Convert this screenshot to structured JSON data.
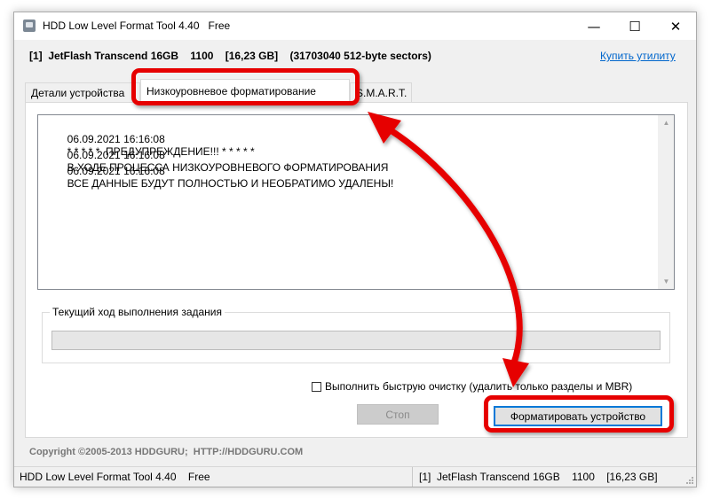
{
  "window": {
    "title": "HDD Low Level Format Tool 4.40   Free",
    "minimize_glyph": "—",
    "maximize_glyph": "☐",
    "close_glyph": "✕"
  },
  "device": {
    "info": "[1]  JetFlash Transcend 16GB    1100    [16,23 GB]    (31703040 512-byte sectors)",
    "buy_link": "Купить утилиту"
  },
  "tabs": [
    {
      "label": "Детали устройства"
    },
    {
      "label": "Низкоуровневое форматирование"
    },
    {
      "label": "S.M.A.R.T."
    }
  ],
  "log": [
    {
      "time": "06.09.2021 16:16:08",
      "text": "* * * * *  ПРЕДУПРЕЖДЕНИЕ!!! * * * * *"
    },
    {
      "time": "06.09.2021 16:16:08",
      "text": "В ХОДЕ ПРОЦЕССА НИЗКОУРОВНЕВОГО ФОРМАТИРОВАНИЯ"
    },
    {
      "time": "06.09.2021 16:16:08",
      "text": "ВСЕ ДАННЫЕ БУДУТ ПОЛНОСТЬЮ И НЕОБРАТИМО УДАЛЕНЫ!"
    }
  ],
  "progress": {
    "label": "Текущий ход выполнения задания",
    "value": 0
  },
  "options": {
    "quick_wipe_label": "Выполнить быструю очистку (удалить только разделы и MBR)",
    "quick_wipe_checked": false
  },
  "buttons": {
    "stop": "Стоп",
    "format": "Форматировать устройство"
  },
  "copyright": "Copyright ©2005-2013 HDDGURU;  HTTP://HDDGURU.COM",
  "statusbar": {
    "left": "HDD Low Level Format Tool 4.40    Free",
    "right": "[1]  JetFlash Transcend 16GB    1100    [16,23 GB]"
  },
  "colors": {
    "annotation": "#e60000",
    "link": "#0066cc",
    "focus": "#0078d7"
  },
  "icons": {
    "app": "app-icon",
    "scroll_up": "scroll-up-icon",
    "scroll_down": "scroll-down-icon",
    "grip": "resize-grip-icon"
  }
}
